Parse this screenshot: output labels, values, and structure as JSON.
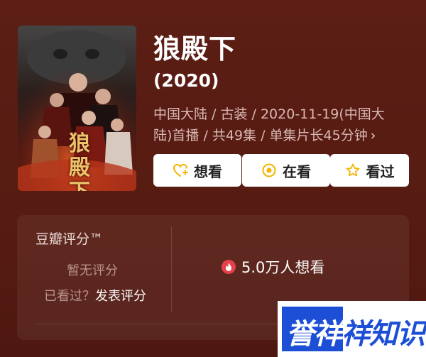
{
  "movie": {
    "title": "狼殿下",
    "year": "(2020)",
    "meta_line1": "中国大陆 / 古装 / 2020-11-19(中国大",
    "meta_line2": "陆)首播 / 共49集 / 单集片长45分钟",
    "meta_chevron": "›",
    "poster_title": "狼殿下"
  },
  "actions": {
    "want": "想看",
    "doing": "在看",
    "done": "看过"
  },
  "rating": {
    "label": "豆瓣评分™",
    "no_rating": "暂无评分",
    "seen_question": "已看过？",
    "post_rating": "发表评分",
    "want_count": "5.0万人想看"
  },
  "watermark": {
    "text": "誉祥祥知识"
  },
  "colors": {
    "background": "#5a1d14",
    "fire": "#e6404a",
    "icon_yellow": "#f2b400",
    "watermark_blue": "#1d4fd6"
  },
  "icons": {
    "want": "heart-plus-icon",
    "doing": "target-circle-icon",
    "done": "star-icon",
    "fire": "fire-icon"
  }
}
